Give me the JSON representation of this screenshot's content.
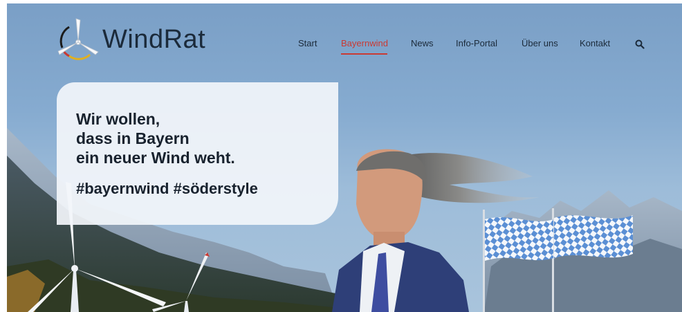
{
  "brand": {
    "name": "WindRat",
    "logo_icon": "wind-turbine-icon"
  },
  "nav": {
    "items": [
      {
        "label": "Start",
        "active": false
      },
      {
        "label": "Bayernwind",
        "active": true
      },
      {
        "label": "News",
        "active": false
      },
      {
        "label": "Info-Portal",
        "active": false
      },
      {
        "label": "Über uns",
        "active": false
      },
      {
        "label": "Kontakt",
        "active": false
      }
    ],
    "search_icon": "search-icon"
  },
  "hero": {
    "headline": [
      "Wir wollen,",
      "dass in Bayern",
      "ein neuer Wind weht."
    ],
    "hashtags": "#bayernwind #söderstyle"
  },
  "colors": {
    "accent": "#c93a33",
    "text_dark": "#1b2a3a",
    "sky": "#86abd0",
    "flag_blue": "#5b8fd4"
  }
}
